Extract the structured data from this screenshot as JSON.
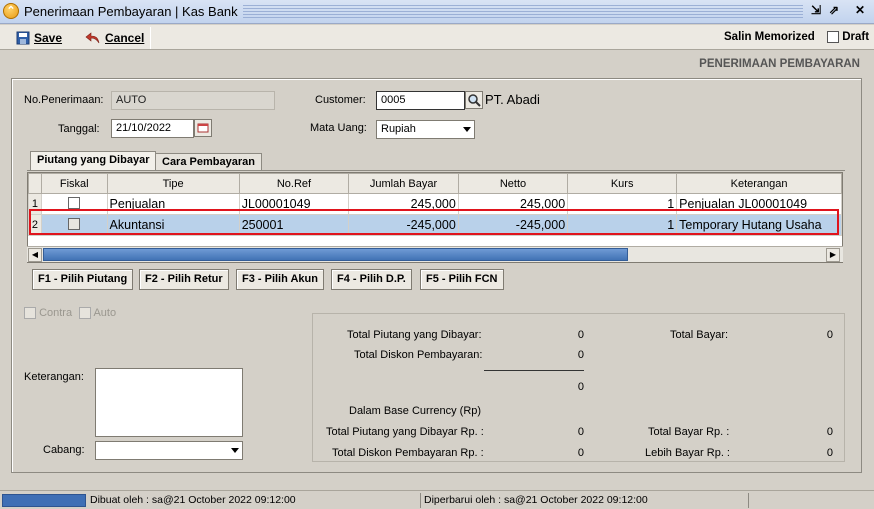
{
  "window": {
    "title": "Penerimaan Pembayaran | Kas Bank",
    "app_icon_glyph": "⌃",
    "restore_glyph": "⇲",
    "maximize_glyph": "⇗",
    "close_glyph": "✕"
  },
  "toolbar": {
    "save_label": "Save",
    "cancel_label": "Cancel",
    "salin_memorized_label": "Salin Memorized",
    "draft_label": "Draft"
  },
  "form": {
    "header_title": "PENERIMAAN PEMBAYARAN",
    "no_penerimaan_label": "No.Penerimaan:",
    "no_penerimaan_value": "AUTO",
    "tanggal_label": "Tanggal:",
    "tanggal_value": "21/10/2022",
    "customer_label": "Customer:",
    "customer_value": "0005",
    "customer_name": "PT. Abadi",
    "mata_uang_label": "Mata Uang:",
    "mata_uang_value": "Rupiah"
  },
  "tabs": [
    {
      "label": "Piutang yang Dibayar",
      "active": true
    },
    {
      "label": "Cara Pembayaran",
      "active": false
    }
  ],
  "grid": {
    "columns": [
      "Fiskal",
      "Tipe",
      "No.Ref",
      "Jumlah Bayar",
      "Netto",
      "Kurs",
      "Keterangan"
    ],
    "rows": [
      {
        "no": "1",
        "fiskal": false,
        "tipe": "Penjualan",
        "noref": "JL00001049",
        "jumlah": "245,000",
        "netto": "245,000",
        "kurs": "1",
        "keterangan": "Penjualan JL00001049"
      },
      {
        "no": "2",
        "fiskal": false,
        "tipe": "Akuntansi",
        "noref": "250001",
        "jumlah": "-245,000",
        "netto": "-245,000",
        "kurs": "1",
        "keterangan": "Temporary Hutang Usaha"
      }
    ],
    "selected_row": 2
  },
  "function_buttons": [
    "F1 - Pilih Piutang",
    "F2 - Pilih Retur",
    "F3 - Pilih Akun",
    "F4 - Pilih D.P.",
    "F5 - Pilih FCN"
  ],
  "options": {
    "contra_label": "Contra",
    "auto_label": "Auto"
  },
  "bottom": {
    "keterangan_label": "Keterangan:",
    "cabang_label": "Cabang:",
    "cabang_value": ""
  },
  "totals": {
    "total_piutang_label": "Total Piutang yang Dibayar:",
    "total_piutang_value": "0",
    "total_diskon_label": "Total Diskon Pembayaran:",
    "total_diskon_value": "0",
    "subtotal_value": "0",
    "total_bayar_label": "Total Bayar:",
    "total_bayar_value": "0",
    "base_currency_label": "Dalam Base Currency (Rp)",
    "total_piutang_rp_label": "Total Piutang yang Dibayar Rp. :",
    "total_piutang_rp_value": "0",
    "total_diskon_rp_label": "Total Diskon Pembayaran Rp. :",
    "total_diskon_rp_value": "0",
    "total_bayar_rp_label": "Total Bayar Rp. :",
    "total_bayar_rp_value": "0",
    "lebih_bayar_rp_label": "Lebih Bayar Rp. :",
    "lebih_bayar_rp_value": "0"
  },
  "status": {
    "dibuat": "Dibuat oleh : sa@21 October 2022  09:12:00",
    "diperbarui": "Diperbarui oleh : sa@21 October 2022  09:12:00"
  }
}
